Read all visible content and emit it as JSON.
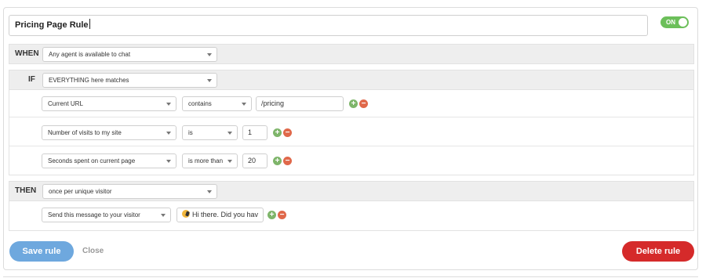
{
  "rule": {
    "name": "Pricing Page Rule"
  },
  "toggle": {
    "label": "ON",
    "state": "on"
  },
  "when": {
    "label": "WHEN",
    "select_value": "Any agent is available to chat"
  },
  "if": {
    "label": "IF",
    "select_value": "EVERYTHING here matches",
    "conditions": [
      {
        "field": "Current URL",
        "operator": "contains",
        "value": "/pricing"
      },
      {
        "field": "Number of visits to my site",
        "operator": "is",
        "value": "1"
      },
      {
        "field": "Seconds spent on current page",
        "operator": "is more than",
        "value": "20"
      }
    ]
  },
  "then": {
    "label": "THEN",
    "select_value": "once per unique visitor",
    "action": {
      "type": "Send this message to your visitor",
      "message": "Hi there. Did you hav"
    }
  },
  "buttons": {
    "save": "Save rule",
    "close": "Close",
    "delete": "Delete rule"
  },
  "icons": {
    "add": "+",
    "remove": "−"
  },
  "colors": {
    "accent_green": "#6cbf5a",
    "save_blue": "#6ea8de",
    "delete_red": "#d52a2a",
    "plus_green": "#7eb56a",
    "minus_red": "#e0684a"
  }
}
